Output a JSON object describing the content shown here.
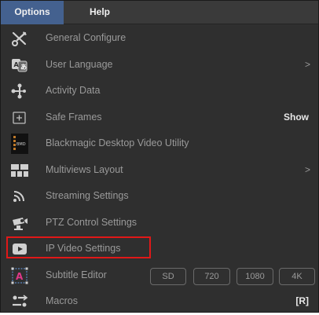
{
  "menubar": {
    "options_label": "Options",
    "help_label": "Help"
  },
  "menu": {
    "general_configure": "General Configure",
    "user_language": "User Language",
    "user_language_arrow": ">",
    "activity_data": "Activity Data",
    "safe_frames": "Safe Frames",
    "safe_frames_value": "Show",
    "blackmagic_utility": "Blackmagic Desktop Video Utility",
    "blackmagic_icon_text": "BMD",
    "multiviews_layout": "Multiviews Layout",
    "multiviews_arrow": ">",
    "streaming_settings": "Streaming Settings",
    "ptz_control_settings": "PTZ Control Settings",
    "ip_video_settings": "IP Video Settings",
    "subtitle_editor": "Subtitle Editor",
    "subtitle_icon_text": "A",
    "resolutions": [
      "SD",
      "720",
      "1080",
      "4K"
    ],
    "macros": "Macros",
    "macros_shortcut": "[R]"
  },
  "colors": {
    "menu_bg": "#2f2f2f",
    "menubar_active": "#44618f",
    "highlight_border": "#e01818",
    "text": "#9a9a9a"
  },
  "icons": [
    "tools-icon",
    "language-icon",
    "activity-icon",
    "safe-frames-icon",
    "blackmagic-icon",
    "multiviews-icon",
    "streaming-icon",
    "ptz-camera-icon",
    "ip-video-icon",
    "subtitle-icon",
    "macros-icon"
  ]
}
